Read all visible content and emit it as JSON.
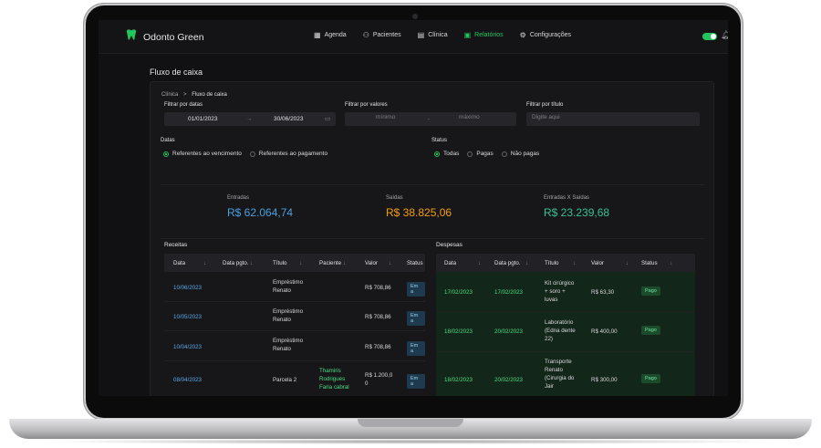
{
  "app": {
    "brand": "Odonto Green",
    "accent": "#22c55e"
  },
  "nav": [
    {
      "label": "Agenda",
      "icon": "calendar-icon"
    },
    {
      "label": "Pacientes",
      "icon": "users-icon"
    },
    {
      "label": "Clínica",
      "icon": "grid-icon"
    },
    {
      "label": "Relatórios",
      "icon": "report-icon",
      "active": true
    },
    {
      "label": "Configurações",
      "icon": "gear-icon"
    }
  ],
  "page": {
    "title": "Fluxo de caixa"
  },
  "breadcrumb": {
    "root": "Clínica",
    "sep": ">",
    "current": "Fluxo de caixa"
  },
  "filters": {
    "dates_label": "Filtrar por datas",
    "date_from": "01/01/2023",
    "date_sep": "→",
    "date_to": "30/06/2023",
    "values_label": "Filtrar por valores",
    "min_placeholder": "mínimo",
    "range_sep": "-",
    "max_placeholder": "máximo",
    "title_label": "Filtrar por título",
    "title_placeholder": "Digite aqui"
  },
  "dates_group": {
    "label": "Datas",
    "options": [
      "Referentes ao vencimento",
      "Referentes ao pagamento"
    ],
    "selected": 0
  },
  "status_group": {
    "label": "Status",
    "options": [
      "Todas",
      "Pagas",
      "Não pagas"
    ],
    "selected": 0
  },
  "summary": {
    "entradas_label": "Entradas",
    "entradas_value": "R$ 62.064,74",
    "entradas_color": "#4a9fe0",
    "saidas_label": "Saídas",
    "saidas_value": "R$ 38.825,06",
    "saidas_color": "#f59e0b",
    "balance_label": "Entradas X Saídas",
    "balance_value": "R$ 23.239,68",
    "balance_color": "#34c38f"
  },
  "receitas": {
    "label": "Receitas",
    "columns": [
      "Data",
      "Data pgto.",
      "Título",
      "Paciente",
      "Valor",
      "Status"
    ],
    "rows": [
      {
        "data": "10/06/2023",
        "pgto": "",
        "titulo": [
          "Empréstimo",
          "Renato"
        ],
        "paciente": [],
        "valor": [
          "R$ 708,86"
        ],
        "status": "Em a"
      },
      {
        "data": "10/05/2023",
        "pgto": "",
        "titulo": [
          "Empréstimo",
          "Renato"
        ],
        "paciente": [],
        "valor": [
          "R$ 708,86"
        ],
        "status": "Em a"
      },
      {
        "data": "10/04/2023",
        "pgto": "",
        "titulo": [
          "Empréstimo",
          "Renato"
        ],
        "paciente": [],
        "valor": [
          "R$ 708,86"
        ],
        "status": "Em a"
      },
      {
        "data": "08/04/2023",
        "pgto": "",
        "titulo": [
          "Parcela 2"
        ],
        "paciente": [
          "Thamiris",
          "Rodrigues",
          "Faria cabral"
        ],
        "valor": [
          "R$ 1.200,0",
          "0"
        ],
        "status": "Em a"
      }
    ]
  },
  "despesas": {
    "label": "Despesas",
    "columns": [
      "Data",
      "Data pgto.",
      "Título",
      "Valor",
      "Status"
    ],
    "rows": [
      {
        "data": "17/02/2023",
        "pgto": "17/02/2023",
        "titulo": [
          "Kit cirúrgico",
          "+ soro +",
          "luvas"
        ],
        "valor": "R$ 63,30",
        "status": "Pago"
      },
      {
        "data": "18/02/2023",
        "pgto": "20/02/2023",
        "titulo": [
          "Laboratório",
          "(Edna dente",
          "22)"
        ],
        "valor": "R$ 400,00",
        "status": "Pago"
      },
      {
        "data": "18/02/2023",
        "pgto": "20/02/2023",
        "titulo": [
          "Transporte",
          "Renato",
          "(Cirurgia do",
          "Jair"
        ],
        "valor": "R$ 300,00",
        "status": "Pago"
      }
    ]
  }
}
